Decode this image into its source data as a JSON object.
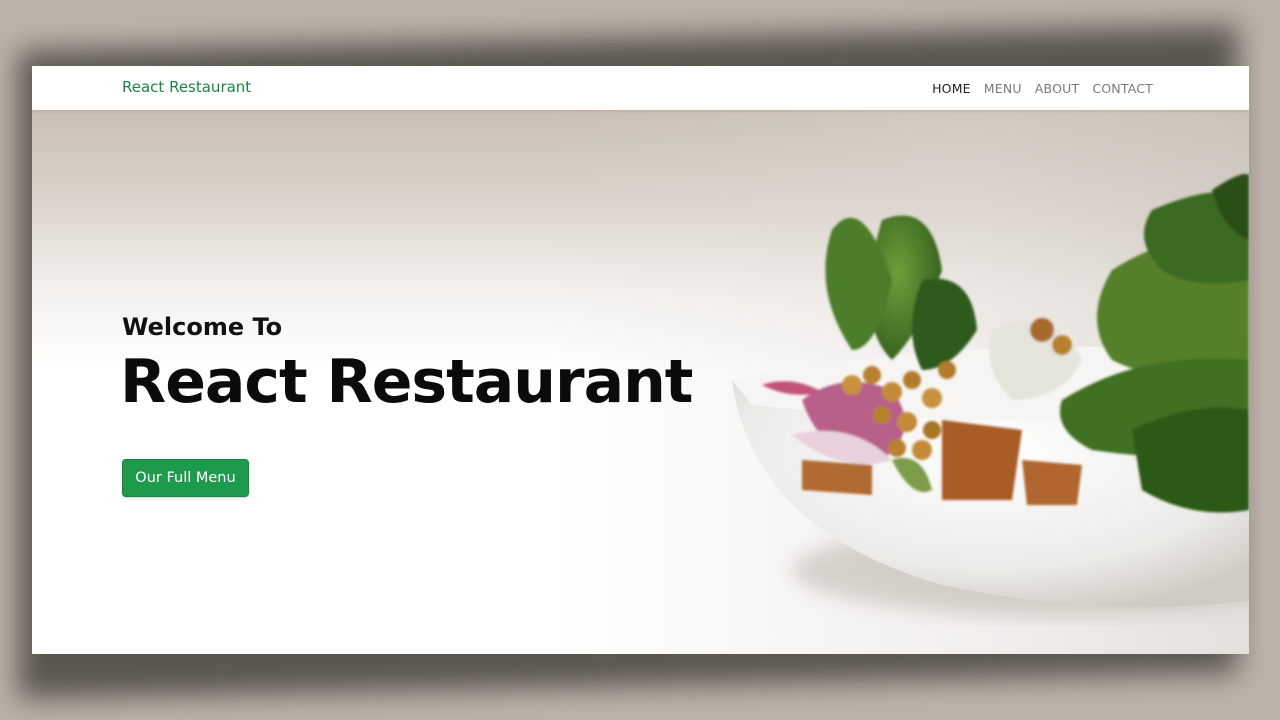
{
  "navbar": {
    "brand": "React Restaurant",
    "links": [
      {
        "label": "HOME",
        "active": true
      },
      {
        "label": "MENU",
        "active": false
      },
      {
        "label": "ABOUT",
        "active": false
      },
      {
        "label": "CONTACT",
        "active": false
      }
    ]
  },
  "hero": {
    "subtitle": "Welcome To",
    "title": "React Restaurant",
    "button_label": "Our Full Menu",
    "image": "salad-bowl-photo"
  },
  "colors": {
    "brand": "#198744",
    "button": "#1e9a4d",
    "nav_active": "#222222",
    "nav_inactive": "#7a7a7a",
    "page_bg": "#bbb3a9"
  }
}
